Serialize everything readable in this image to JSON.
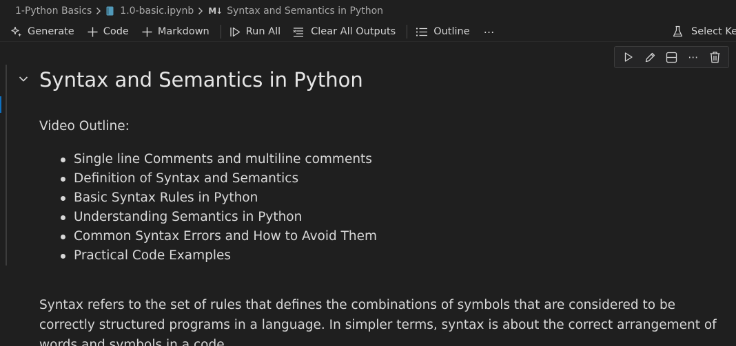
{
  "breadcrumb": {
    "folder": "1-Python Basics",
    "notebook": "1.0-basic.ipynb",
    "markdown_marker": "M↓",
    "section": "Syntax and Semantics in Python"
  },
  "toolbar": {
    "generate": "Generate",
    "code": "Code",
    "markdown": "Markdown",
    "run_all": "Run All",
    "clear_outputs": "Clear All Outputs",
    "outline": "Outline",
    "more": "⋯",
    "select_kernel": "Select Ke"
  },
  "cell_toolbar": {
    "more": "⋯"
  },
  "cell": {
    "heading": "Syntax and Semantics in Python",
    "intro": "Video Outline:",
    "outline_items": [
      "Single line Comments and multiline comments",
      "Definition of Syntax and Semantics",
      "Basic Syntax Rules in Python",
      "Understanding Semantics in Python",
      "Common Syntax Errors and How to Avoid Them",
      "Practical Code Examples"
    ],
    "paragraph": "Syntax refers to the set of rules that defines the combinations of symbols that are considered to be correctly structured programs in a language. In simpler terms, syntax is about the correct arrangement of words and symbols in a code."
  },
  "colors": {
    "background": "#1f1f1f",
    "focus_indicator": "#0e70c0",
    "notebook_icon": "#519aba"
  },
  "icons": {
    "generate": "sparkle-icon",
    "code": "plus-icon",
    "markdown": "plus-icon",
    "run_all": "run-all-icon",
    "clear_outputs": "clear-all-icon",
    "outline": "list-icon",
    "kernel": "flask-icon",
    "cell_run": "play-icon",
    "cell_edit": "pencil-icon",
    "cell_split": "split-cell-icon",
    "cell_delete": "trash-icon",
    "collapse": "chevron-down-icon"
  }
}
